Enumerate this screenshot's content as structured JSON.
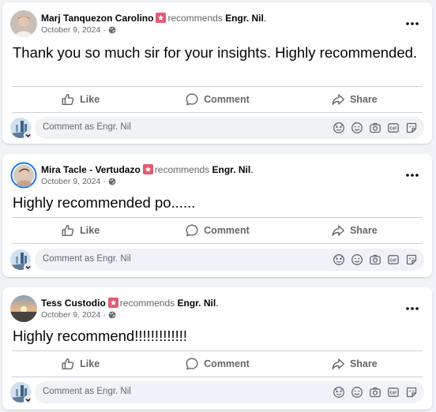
{
  "posts": [
    {
      "author": "Marj Tanquezon Carolino",
      "verb": "recommends",
      "page": "Engr. Nil",
      "date": "October 9, 2024",
      "text": "Thank you so much sir for your insights. Highly recommended."
    },
    {
      "author": "Mira Tacle - Vertudazo",
      "verb": "recommends",
      "page": "Engr. Nil",
      "date": "October 9, 2024",
      "text": "Highly recommended po......"
    },
    {
      "author": "Tess Custodio",
      "verb": "recommends",
      "page": "Engr. Nil",
      "date": "October 9, 2024",
      "text": "Highly recommend!!!!!!!!!!!!!"
    }
  ],
  "actions": {
    "like": "Like",
    "comment": "Comment",
    "share": "Share"
  },
  "composer": {
    "placeholder": "Comment as Engr. Nil"
  },
  "colors": {
    "badge": "#e35b75",
    "secondary_text": "#65676b",
    "divider": "#ced0d4"
  }
}
